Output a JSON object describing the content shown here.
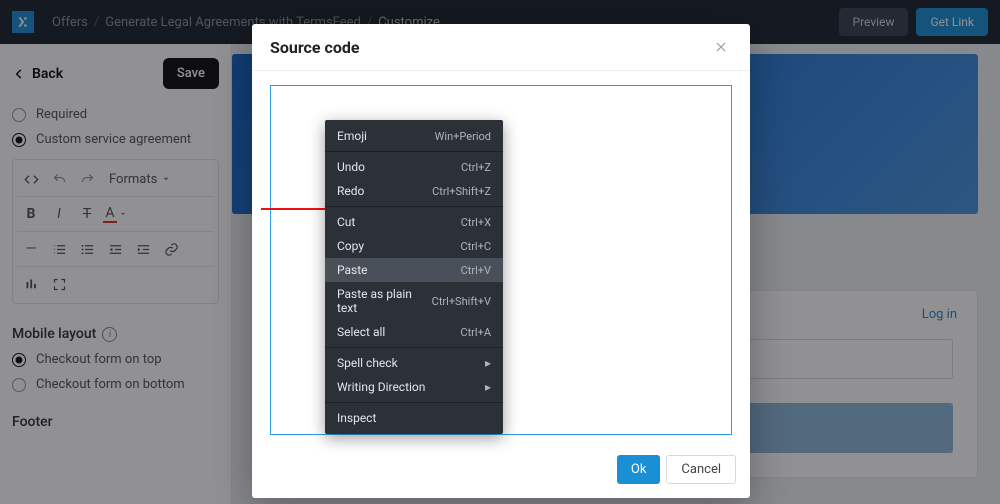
{
  "breadcrumb": {
    "a": "Offers",
    "b": "Generate Legal Agreements with TermsFeed",
    "c": "Customize"
  },
  "topbar": {
    "preview": "Preview",
    "getlink": "Get Link"
  },
  "sidebar": {
    "back": "Back",
    "save": "Save",
    "required": "Required",
    "custom": "Custom service agreement",
    "formats": "Formats",
    "mobile_layout": "Mobile layout",
    "opt_top": "Checkout form on top",
    "opt_bottom": "Checkout form on bottom",
    "footer": "Footer"
  },
  "preview": {
    "login": "Log in"
  },
  "modal": {
    "title": "Source code",
    "ok": "Ok",
    "cancel": "Cancel",
    "context": {
      "emoji": "Emoji",
      "emoji_sc": "Win+Period",
      "undo": "Undo",
      "undo_sc": "Ctrl+Z",
      "redo": "Redo",
      "redo_sc": "Ctrl+Shift+Z",
      "cut": "Cut",
      "cut_sc": "Ctrl+X",
      "copy": "Copy",
      "copy_sc": "Ctrl+C",
      "paste": "Paste",
      "paste_sc": "Ctrl+V",
      "paste_plain": "Paste as plain text",
      "paste_plain_sc": "Ctrl+Shift+V",
      "select_all": "Select all",
      "select_all_sc": "Ctrl+A",
      "spell": "Spell check",
      "writing": "Writing Direction",
      "inspect": "Inspect"
    }
  }
}
